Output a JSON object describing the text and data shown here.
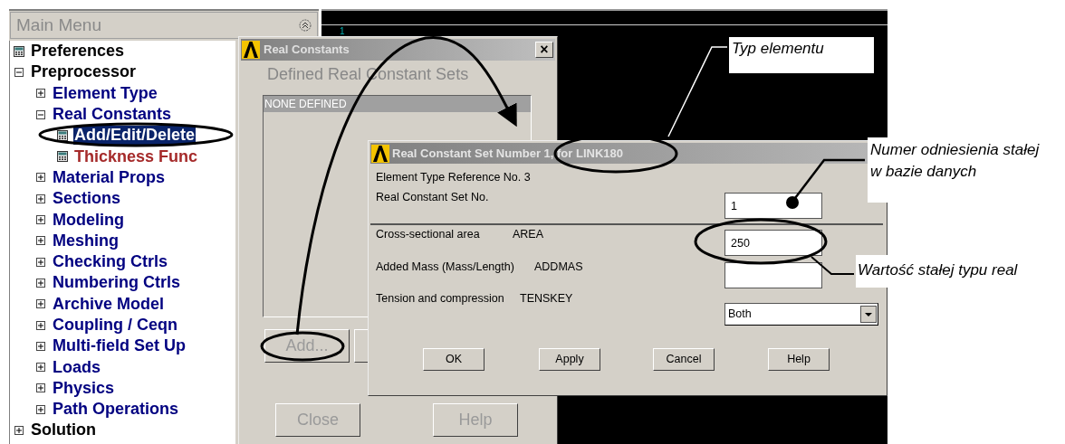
{
  "main_menu": {
    "title": "Main Menu",
    "tree": [
      {
        "label": "Preferences",
        "kind": "leaf",
        "selected": false,
        "color": "#000000"
      },
      {
        "label": "Preprocessor",
        "kind": "folder",
        "expanded": true,
        "selected": false,
        "color": "#000000",
        "children": [
          {
            "label": "Element Type",
            "kind": "folder",
            "expanded": false,
            "selected": false,
            "color": "#000080"
          },
          {
            "label": "Real Constants",
            "kind": "folder",
            "expanded": true,
            "selected": false,
            "color": "#000080",
            "children": [
              {
                "label": "Add/Edit/Delete",
                "kind": "leaf",
                "selected": true
              },
              {
                "label": "Thickness Func",
                "kind": "leaf",
                "selected": false,
                "color": "#a52a2a"
              }
            ]
          },
          {
            "label": "Material Props",
            "kind": "folder",
            "expanded": false,
            "selected": false,
            "color": "#000080"
          },
          {
            "label": "Sections",
            "kind": "folder",
            "expanded": false,
            "selected": false,
            "color": "#000080"
          },
          {
            "label": "Modeling",
            "kind": "folder",
            "expanded": false,
            "selected": false,
            "color": "#000080"
          },
          {
            "label": "Meshing",
            "kind": "folder",
            "expanded": false,
            "selected": false,
            "color": "#000080"
          },
          {
            "label": "Checking Ctrls",
            "kind": "folder",
            "expanded": false,
            "selected": false,
            "color": "#000080"
          },
          {
            "label": "Numbering Ctrls",
            "kind": "folder",
            "expanded": false,
            "selected": false,
            "color": "#000080"
          },
          {
            "label": "Archive Model",
            "kind": "folder",
            "expanded": false,
            "selected": false,
            "color": "#000080"
          },
          {
            "label": "Coupling / Ceqn",
            "kind": "folder",
            "expanded": false,
            "selected": false,
            "color": "#000080"
          },
          {
            "label": "Multi-field Set Up",
            "kind": "folder",
            "expanded": false,
            "selected": false,
            "color": "#000080"
          },
          {
            "label": "Loads",
            "kind": "folder",
            "expanded": false,
            "selected": false,
            "color": "#000080"
          },
          {
            "label": "Physics",
            "kind": "folder",
            "expanded": false,
            "selected": false,
            "color": "#000080"
          },
          {
            "label": "Path Operations",
            "kind": "folder",
            "expanded": false,
            "selected": false,
            "color": "#000080"
          }
        ]
      },
      {
        "label": "Solution",
        "kind": "folder",
        "expanded": false,
        "selected": false,
        "color": "#000000"
      }
    ]
  },
  "graphics_window": {
    "label": "1"
  },
  "real_constants_dialog": {
    "title": "Real Constants",
    "close": "×",
    "heading": "Defined Real Constant Sets",
    "list": [
      "NONE DEFINED"
    ],
    "buttons": [
      {
        "label": "Add...",
        "disabled": true
      },
      {
        "label": "Close",
        "disabled": true
      },
      {
        "label": "Help",
        "disabled": true
      }
    ]
  },
  "set_dialog": {
    "title": "Real Constant Set Number 1, for LINK180",
    "info": "Element Type Reference No. 3",
    "rows": [
      {
        "label": "Real Constant Set No.",
        "kind": "field",
        "value": "1"
      },
      {
        "label": "Cross-sectional area",
        "param": "AREA",
        "kind": "field",
        "value": "250"
      },
      {
        "label": "Added Mass (Mass/Length)",
        "param": "ADDMAS",
        "kind": "field"
      },
      {
        "label": "Tension and compression",
        "param": "TENSKEY",
        "kind": "select",
        "value": "Both"
      }
    ],
    "buttons": [
      "OK",
      "Apply",
      "Cancel",
      "Help"
    ]
  },
  "callouts": [
    "Typ elementu",
    "Numer odniesienia stałej w bazie danych",
    "Wartość stałej typu real"
  ]
}
